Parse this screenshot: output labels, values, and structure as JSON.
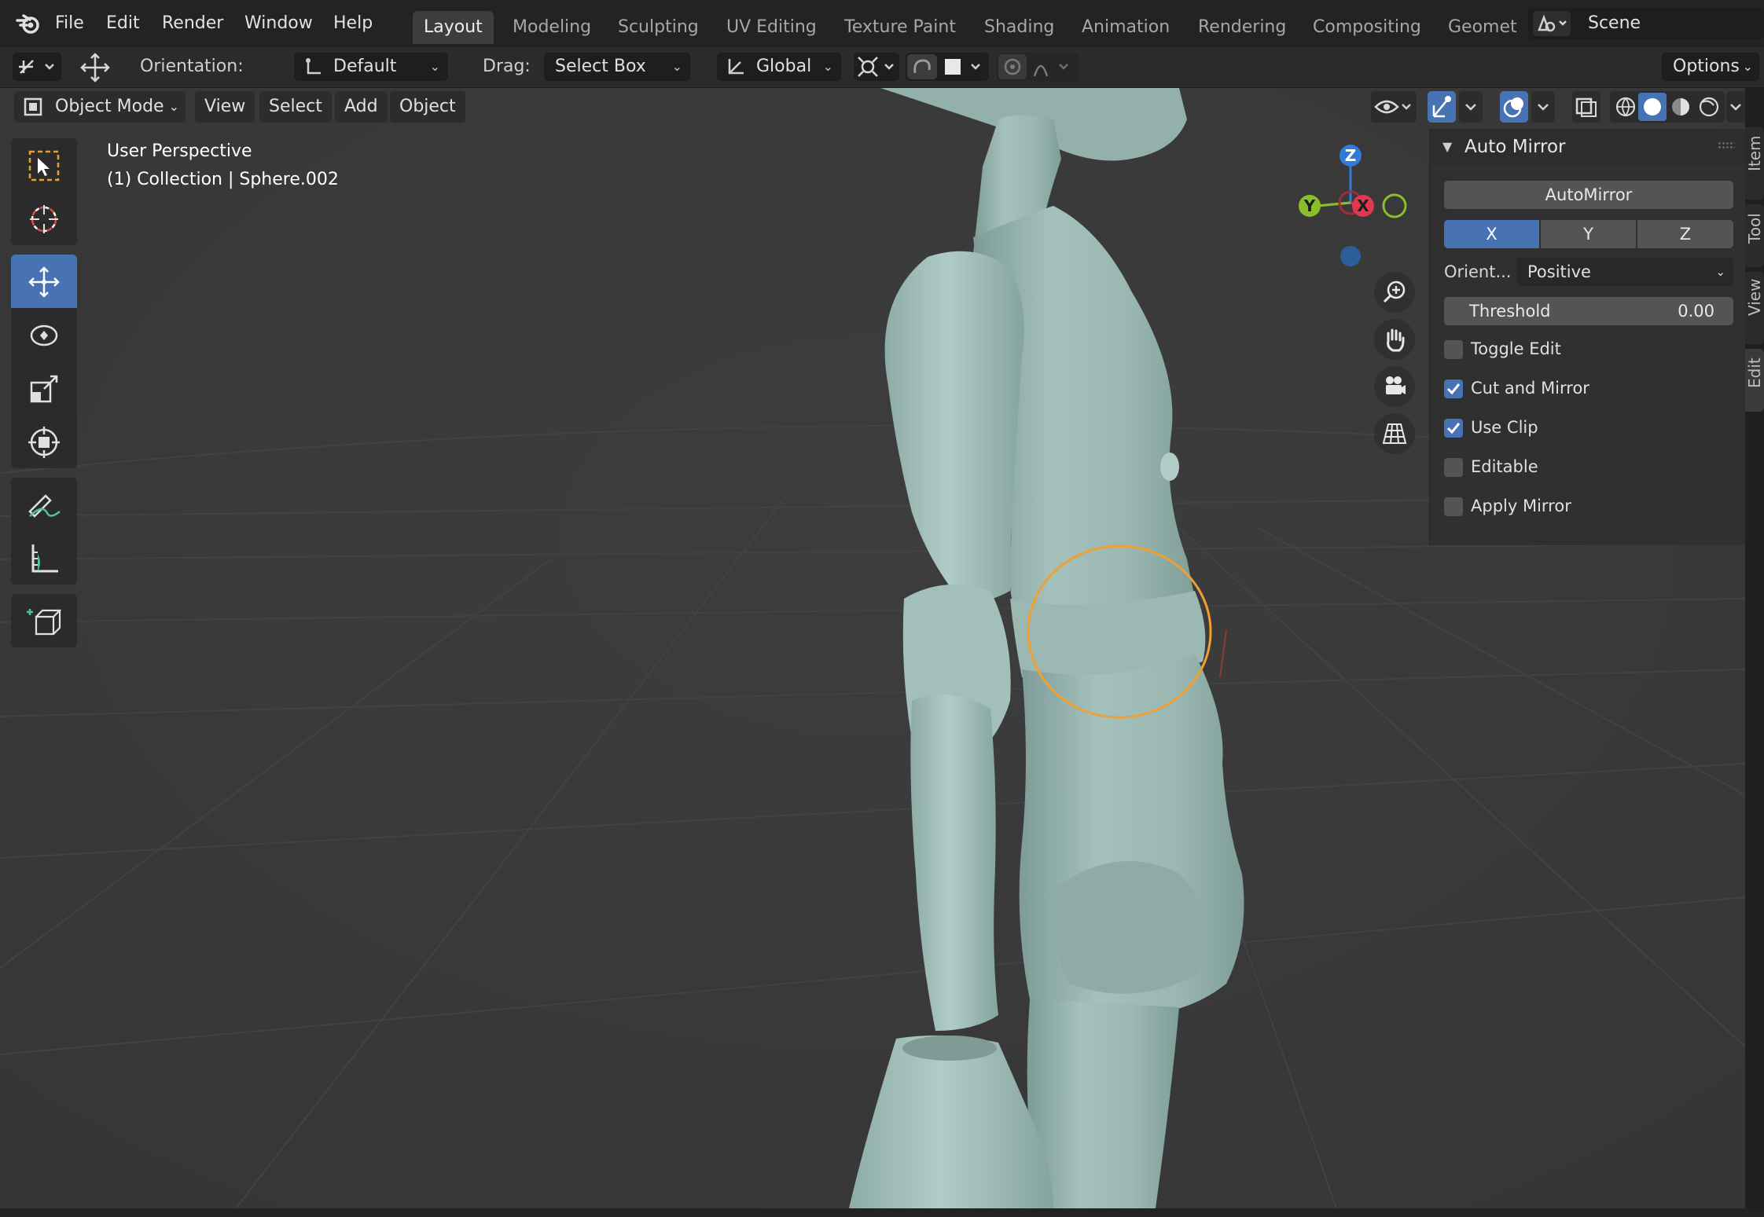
{
  "topbar": {
    "menus": [
      "File",
      "Edit",
      "Render",
      "Window",
      "Help"
    ],
    "workspaces": [
      "Layout",
      "Modeling",
      "Sculpting",
      "UV Editing",
      "Texture Paint",
      "Shading",
      "Animation",
      "Rendering",
      "Compositing",
      "Geomet"
    ],
    "active_workspace": "Layout",
    "scene": "Scene"
  },
  "toolheader": {
    "orientation_label": "Orientation:",
    "orientation_value": "Default",
    "drag_label": "Drag:",
    "drag_value": "Select Box",
    "transform_orientation": "Global",
    "options_label": "Options"
  },
  "viewport_header": {
    "mode": "Object Mode",
    "menus": [
      "View",
      "Select",
      "Add",
      "Object"
    ]
  },
  "viewport_overlay": {
    "line1": "User Perspective",
    "line2": "(1) Collection | Sphere.002"
  },
  "gizmo": {
    "z": "Z",
    "y": "Y",
    "x": "X",
    "colors": {
      "x": "#e0384e",
      "y": "#8bbf2a",
      "z": "#2f7bd6",
      "neg_x": "#a22b3c",
      "neg_y": "#5d8a1f",
      "neg_z": "#2a5f99"
    }
  },
  "tools": [
    "select-box",
    "cursor",
    "move",
    "rotate",
    "scale",
    "transform",
    "annotate",
    "measure",
    "add-cube"
  ],
  "npanel": {
    "title": "Auto Mirror",
    "automirror_button": "AutoMirror",
    "axes": [
      {
        "label": "X",
        "active": true
      },
      {
        "label": "Y",
        "active": false
      },
      {
        "label": "Z",
        "active": false
      }
    ],
    "orient_label": "Orient...",
    "orient_value": "Positive",
    "threshold_label": "Threshold",
    "threshold_value": "0.00",
    "checkboxes": [
      {
        "label": "Toggle Edit",
        "checked": false
      },
      {
        "label": "Cut and Mirror",
        "checked": true
      },
      {
        "label": "Use Clip",
        "checked": true
      },
      {
        "label": "Editable",
        "checked": false
      },
      {
        "label": "Apply Mirror",
        "checked": false
      }
    ]
  },
  "side_tabs": [
    "Item",
    "Tool",
    "View",
    "Edit"
  ],
  "active_side_tab": "Edit",
  "colors": {
    "accent": "#4772b3",
    "selection_outline": "#f0a030",
    "model": "#9dbab5"
  }
}
